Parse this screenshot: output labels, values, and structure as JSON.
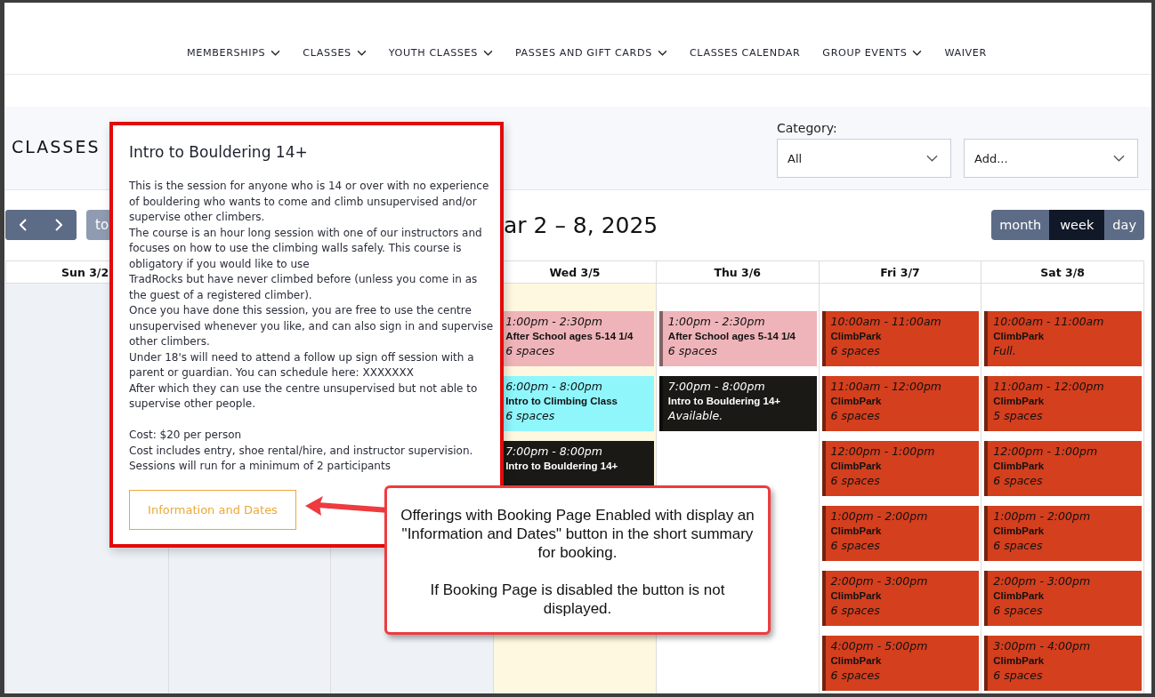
{
  "nav": [
    {
      "label": "MEMBERSHIPS",
      "dropdown": true
    },
    {
      "label": "CLASSES",
      "dropdown": true
    },
    {
      "label": "YOUTH CLASSES",
      "dropdown": true
    },
    {
      "label": "PASSES AND GIFT CARDS",
      "dropdown": true
    },
    {
      "label": "CLASSES CALENDAR",
      "dropdown": false
    },
    {
      "label": "GROUP EVENTS",
      "dropdown": true
    },
    {
      "label": "WAIVER",
      "dropdown": false
    }
  ],
  "page_title": "CLASSES",
  "filter": {
    "label": "Category:",
    "category_value": "All",
    "add_value": "Add..."
  },
  "toolbar": {
    "today_button": "to",
    "range_title": "ar 2 – 8, 2025",
    "views": [
      {
        "label": "month",
        "selected": false
      },
      {
        "label": "week",
        "selected": true
      },
      {
        "label": "day",
        "selected": false
      }
    ]
  },
  "calendar": {
    "days": [
      {
        "label": "Sun 3/2",
        "kind": "past"
      },
      {
        "kind": "past"
      },
      {
        "kind": "past"
      },
      {
        "label": "Wed 3/5",
        "kind": "today",
        "events": [
          {
            "time": "1:00pm - 2:30pm",
            "title": "After School ages 5-14 1/4",
            "status": "6 spaces",
            "color": "#efb4b9"
          },
          {
            "time": "6:00pm - 8:00pm",
            "title": "Intro to Climbing Class",
            "status": "6 spaces",
            "color": "#8ff6fc"
          },
          {
            "time": "7:00pm - 8:00pm",
            "title": "Intro to Bouldering 14+",
            "color": "#1a1915"
          }
        ]
      },
      {
        "label": "Thu 3/6",
        "kind": "future",
        "events": [
          {
            "time": "1:00pm - 2:30pm",
            "title": "After School ages 5-14 1/4",
            "status": "6 spaces",
            "color": "#efb4b9"
          },
          {
            "time": "7:00pm - 8:00pm",
            "title": "Intro to Bouldering 14+",
            "status": "Available.",
            "color": "#1a1915"
          }
        ]
      },
      {
        "label": "Fri 3/7",
        "kind": "future",
        "events": [
          {
            "time": "10:00am - 11:00am",
            "title": "ClimbPark",
            "status": "6 spaces",
            "color": "#d43f1e"
          },
          {
            "time": "11:00am - 12:00pm",
            "title": "ClimbPark",
            "status": "6 spaces",
            "color": "#d43f1e"
          },
          {
            "time": "12:00pm - 1:00pm",
            "title": "ClimbPark",
            "status": "6 spaces",
            "color": "#d43f1e"
          },
          {
            "time": "1:00pm - 2:00pm",
            "title": "ClimbPark",
            "status": "6 spaces",
            "color": "#d43f1e"
          },
          {
            "time": "2:00pm - 3:00pm",
            "title": "ClimbPark",
            "status": "6 spaces",
            "color": "#d43f1e"
          },
          {
            "time": "4:00pm - 5:00pm",
            "title": "ClimbPark",
            "status": "6 spaces",
            "color": "#d43f1e"
          }
        ]
      },
      {
        "label": "Sat 3/8",
        "kind": "future",
        "events": [
          {
            "time": "10:00am - 11:00am",
            "title": "ClimbPark",
            "status": "Full.",
            "color": "#d43f1e"
          },
          {
            "time": "11:00am - 12:00pm",
            "title": "ClimbPark",
            "status": "5 spaces",
            "color": "#d43f1e"
          },
          {
            "time": "12:00pm - 1:00pm",
            "title": "ClimbPark",
            "status": "6 spaces",
            "color": "#d43f1e"
          },
          {
            "time": "1:00pm - 2:00pm",
            "title": "ClimbPark",
            "status": "6 spaces",
            "color": "#d43f1e"
          },
          {
            "time": "2:00pm - 3:00pm",
            "title": "ClimbPark",
            "status": "6 spaces",
            "color": "#d43f1e"
          },
          {
            "time": "3:00pm - 4:00pm",
            "title": "ClimbPark",
            "status": "6 spaces",
            "color": "#d43f1e"
          }
        ]
      }
    ]
  },
  "popup": {
    "title": "Intro to Bouldering 14+",
    "paragraphs": [
      "This is the session for anyone who is 14 or over with no experience of bouldering who wants to come and climb unsupervised and/or supervise other climbers.",
      "The course is an hour long session with one of our instructors and focuses on how to use the climbing walls safely. This course is obligatory if you would like to use",
      "TradRocks but have never climbed before (unless you come in as the guest of a registered climber).",
      "Once you have done this session, you are free to use the centre unsupervised whenever you like, and can also sign in and supervise other climbers.",
      "Under 18's will need to attend a follow up sign off session with a parent or guardian. You can schedule here: XXXXXXX",
      "After which they can use the centre unsupervised but not able to supervise other people."
    ],
    "cost_lines": [
      "Cost: $20 per person",
      "Cost includes entry, shoe rental/hire, and instructor supervision.",
      "Sessions will run for a minimum of 2 participants"
    ],
    "button": "Information and Dates"
  },
  "callout": {
    "paragraphs": [
      "Offerings with Booking Page Enabled with display an \"Information and Dates\" button in the short summary for booking.",
      "If Booking Page is disabled the button is not displayed."
    ]
  }
}
